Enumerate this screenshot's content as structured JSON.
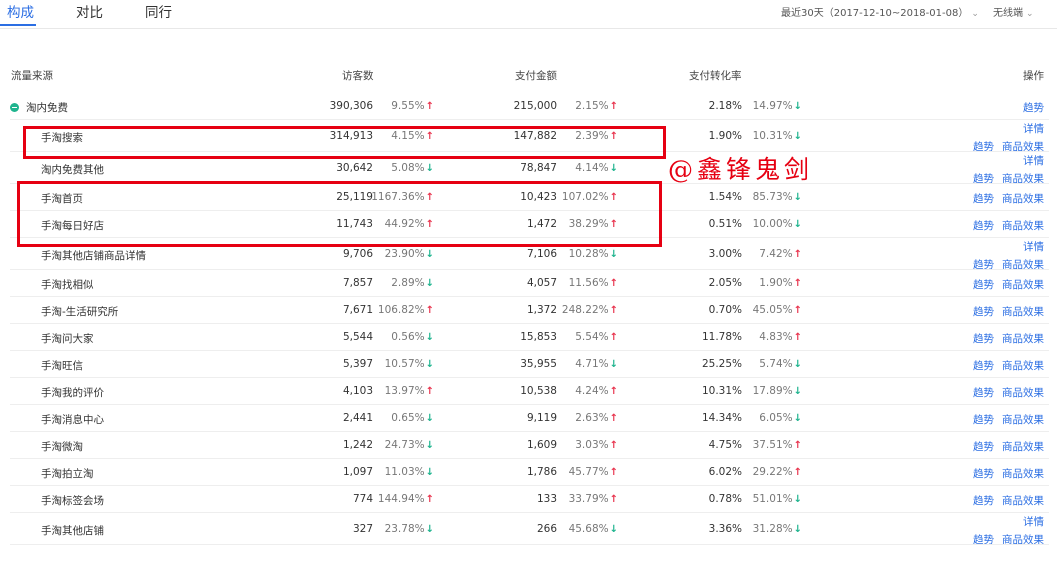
{
  "tabs": [
    "构成",
    "对比",
    "同行"
  ],
  "range": "最近30天（2017-12-10~2018-01-08）",
  "device": "无线端",
  "headers": {
    "source": "流量来源",
    "visitors": "访客数",
    "payment": "支付金额",
    "conversion": "支付转化率",
    "ops": "操作"
  },
  "link_labels": {
    "detail": "详情",
    "trend": "趋势",
    "effect": "商品效果"
  },
  "group": {
    "name": "淘内免费",
    "visitors": "390,306",
    "visitors_pct": "9.55%",
    "visitors_dir": "up",
    "payment": "215,000",
    "payment_pct": "2.15%",
    "payment_dir": "up",
    "conversion": "2.18%",
    "conversion_pct": "14.97%",
    "conversion_dir": "down"
  },
  "rows": [
    {
      "name": "手淘搜索",
      "visitors": "314,913",
      "visitors_pct": "4.15%",
      "visitors_dir": "up",
      "payment": "147,882",
      "payment_pct": "2.39%",
      "payment_dir": "up",
      "conversion": "1.90%",
      "conversion_pct": "10.31%",
      "conversion_dir": "down",
      "detail": true
    },
    {
      "name": "淘内免费其他",
      "visitors": "30,642",
      "visitors_pct": "5.08%",
      "visitors_dir": "down",
      "payment": "78,847",
      "payment_pct": "4.14%",
      "payment_dir": "down",
      "conversion": "",
      "conversion_pct": "",
      "conversion_dir": "",
      "detail": true
    },
    {
      "name": "手淘首页",
      "visitors": "25,119",
      "visitors_pct": "1167.36%",
      "visitors_dir": "up",
      "payment": "10,423",
      "payment_pct": "107.02%",
      "payment_dir": "up",
      "conversion": "1.54%",
      "conversion_pct": "85.73%",
      "conversion_dir": "down",
      "detail": false
    },
    {
      "name": "手淘每日好店",
      "visitors": "11,743",
      "visitors_pct": "44.92%",
      "visitors_dir": "up",
      "payment": "1,472",
      "payment_pct": "38.29%",
      "payment_dir": "up",
      "conversion": "0.51%",
      "conversion_pct": "10.00%",
      "conversion_dir": "down",
      "detail": false
    },
    {
      "name": "手淘其他店铺商品详情",
      "visitors": "9,706",
      "visitors_pct": "23.90%",
      "visitors_dir": "down",
      "payment": "7,106",
      "payment_pct": "10.28%",
      "payment_dir": "down",
      "conversion": "3.00%",
      "conversion_pct": "7.42%",
      "conversion_dir": "up",
      "detail": true
    },
    {
      "name": "手淘找相似",
      "visitors": "7,857",
      "visitors_pct": "2.89%",
      "visitors_dir": "down",
      "payment": "4,057",
      "payment_pct": "11.56%",
      "payment_dir": "up",
      "conversion": "2.05%",
      "conversion_pct": "1.90%",
      "conversion_dir": "up",
      "detail": false
    },
    {
      "name": "手淘-生活研究所",
      "visitors": "7,671",
      "visitors_pct": "106.82%",
      "visitors_dir": "up",
      "payment": "1,372",
      "payment_pct": "248.22%",
      "payment_dir": "up",
      "conversion": "0.70%",
      "conversion_pct": "45.05%",
      "conversion_dir": "up",
      "detail": false
    },
    {
      "name": "手淘问大家",
      "visitors": "5,544",
      "visitors_pct": "0.56%",
      "visitors_dir": "down",
      "payment": "15,853",
      "payment_pct": "5.54%",
      "payment_dir": "up",
      "conversion": "11.78%",
      "conversion_pct": "4.83%",
      "conversion_dir": "up",
      "detail": false
    },
    {
      "name": "手淘旺信",
      "visitors": "5,397",
      "visitors_pct": "10.57%",
      "visitors_dir": "down",
      "payment": "35,955",
      "payment_pct": "4.71%",
      "payment_dir": "down",
      "conversion": "25.25%",
      "conversion_pct": "5.74%",
      "conversion_dir": "down",
      "detail": false
    },
    {
      "name": "手淘我的评价",
      "visitors": "4,103",
      "visitors_pct": "13.97%",
      "visitors_dir": "up",
      "payment": "10,538",
      "payment_pct": "4.24%",
      "payment_dir": "up",
      "conversion": "10.31%",
      "conversion_pct": "17.89%",
      "conversion_dir": "down",
      "detail": false
    },
    {
      "name": "手淘消息中心",
      "visitors": "2,441",
      "visitors_pct": "0.65%",
      "visitors_dir": "down",
      "payment": "9,119",
      "payment_pct": "2.63%",
      "payment_dir": "up",
      "conversion": "14.34%",
      "conversion_pct": "6.05%",
      "conversion_dir": "down",
      "detail": false
    },
    {
      "name": "手淘微淘",
      "visitors": "1,242",
      "visitors_pct": "24.73%",
      "visitors_dir": "down",
      "payment": "1,609",
      "payment_pct": "3.03%",
      "payment_dir": "up",
      "conversion": "4.75%",
      "conversion_pct": "37.51%",
      "conversion_dir": "up",
      "detail": false
    },
    {
      "name": "手淘拍立淘",
      "visitors": "1,097",
      "visitors_pct": "11.03%",
      "visitors_dir": "down",
      "payment": "1,786",
      "payment_pct": "45.77%",
      "payment_dir": "up",
      "conversion": "6.02%",
      "conversion_pct": "29.22%",
      "conversion_dir": "up",
      "detail": false
    },
    {
      "name": "手淘标签会场",
      "visitors": "774",
      "visitors_pct": "144.94%",
      "visitors_dir": "up",
      "payment": "133",
      "payment_pct": "33.79%",
      "payment_dir": "up",
      "conversion": "0.78%",
      "conversion_pct": "51.01%",
      "conversion_dir": "down",
      "detail": false
    },
    {
      "name": "手淘其他店铺",
      "visitors": "327",
      "visitors_pct": "23.78%",
      "visitors_dir": "down",
      "payment": "266",
      "payment_pct": "45.68%",
      "payment_dir": "down",
      "conversion": "3.36%",
      "conversion_pct": "31.28%",
      "conversion_dir": "down",
      "detail": true
    }
  ],
  "watermark": "@鑫锋鬼剑"
}
